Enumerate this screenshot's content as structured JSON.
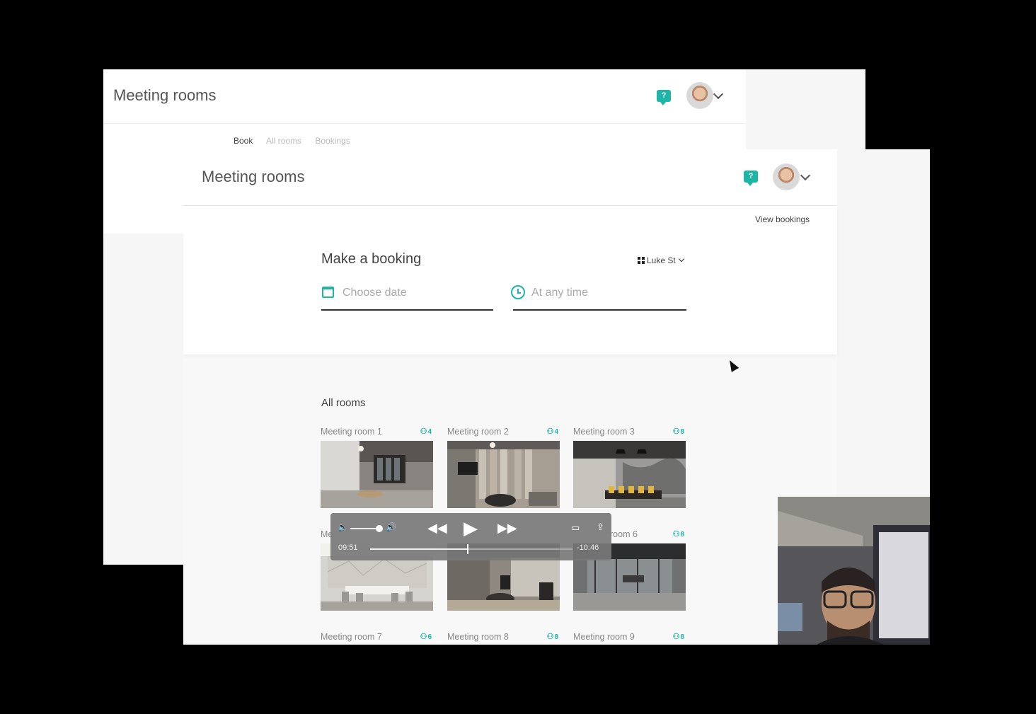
{
  "back_window": {
    "title": "Meeting rooms",
    "tabs": [
      {
        "label": "Book",
        "active": true
      },
      {
        "label": "All rooms",
        "active": false
      },
      {
        "label": "Bookings",
        "active": false
      }
    ],
    "help_icon": "question-chat-icon"
  },
  "front_window": {
    "title": "Meeting rooms",
    "view_bookings": "View bookings",
    "help_icon": "question-chat-icon",
    "booking": {
      "title": "Make a booking",
      "location": "Luke St",
      "date_placeholder": "Choose date",
      "time_placeholder": "At any time"
    },
    "all_rooms_title": "All rooms",
    "rooms": [
      {
        "name": "Meeting room 1",
        "capacity": "4"
      },
      {
        "name": "Meeting room 2",
        "capacity": "4"
      },
      {
        "name": "Meeting room 3",
        "capacity": "8"
      },
      {
        "name": "Me",
        "capacity": ""
      },
      {
        "name": "",
        "capacity": ""
      },
      {
        "name": "room 6",
        "capacity": "8"
      },
      {
        "name": "Meeting room 7",
        "capacity": "6"
      },
      {
        "name": "Meeting room 8",
        "capacity": "8"
      },
      {
        "name": "Meeting room 9",
        "capacity": "8"
      }
    ]
  },
  "video_controls": {
    "elapsed": "09:51",
    "remaining": "-10:46",
    "progress": 0.48
  },
  "colors": {
    "accent": "#1cb5a8",
    "background": "#000000"
  }
}
